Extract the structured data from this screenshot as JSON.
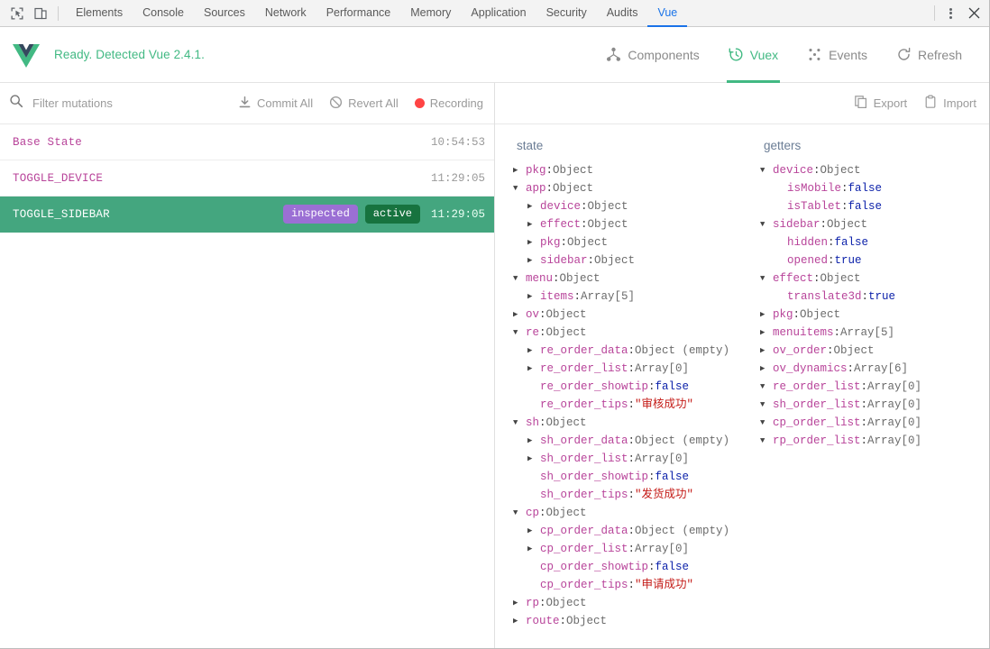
{
  "devtools": {
    "icons": {
      "inspect": "inspect-element-icon",
      "device": "device-toolbar-icon",
      "kebab": "more-options-icon",
      "close": "close-icon"
    },
    "tabs": [
      {
        "label": "Elements",
        "active": false
      },
      {
        "label": "Console",
        "active": false
      },
      {
        "label": "Sources",
        "active": false
      },
      {
        "label": "Network",
        "active": false
      },
      {
        "label": "Performance",
        "active": false
      },
      {
        "label": "Memory",
        "active": false
      },
      {
        "label": "Application",
        "active": false
      },
      {
        "label": "Security",
        "active": false
      },
      {
        "label": "Audits",
        "active": false
      },
      {
        "label": "Vue",
        "active": true
      }
    ]
  },
  "vue_header": {
    "logo": "vue-logo-icon",
    "status": "Ready. Detected Vue 2.4.1.",
    "actions": [
      {
        "label": "Components",
        "icon": "components-tree-icon",
        "active": false
      },
      {
        "label": "Vuex",
        "icon": "vuex-history-icon",
        "active": true
      },
      {
        "label": "Events",
        "icon": "events-dots-icon",
        "active": false
      },
      {
        "label": "Refresh",
        "icon": "refresh-icon",
        "active": false
      }
    ],
    "accent": "#42b983"
  },
  "mutations_panel": {
    "toolbar": {
      "search_icon": "search-icon",
      "filter_placeholder": "Filter mutations",
      "filter_value": "",
      "commit_all": "Commit All",
      "revert_all": "Revert All",
      "recording": "Recording",
      "recording_color": "#ff4444"
    },
    "rows": [
      {
        "name": "Base State",
        "time": "10:54:53",
        "badges": [],
        "active": false
      },
      {
        "name": "TOGGLE_DEVICE",
        "time": "11:29:05",
        "badges": [],
        "active": false
      },
      {
        "name": "TOGGLE_SIDEBAR",
        "time": "11:29:05",
        "badges": [
          "inspected",
          "active"
        ],
        "active": true
      }
    ],
    "badge_colors": {
      "inspected": "#9b6fd4",
      "active": "#17733f",
      "row_active": "#44a67f"
    }
  },
  "inspector": {
    "toolbar": {
      "export": "Export",
      "export_icon": "copy-icon",
      "import": "Import",
      "import_icon": "clipboard-icon"
    },
    "state": {
      "title": "state",
      "rows": [
        {
          "indent": 0,
          "caret": "collapsed",
          "key": "pkg",
          "value": "Object",
          "type": "object"
        },
        {
          "indent": 0,
          "caret": "expanded",
          "key": "app",
          "value": "Object",
          "type": "object"
        },
        {
          "indent": 1,
          "caret": "collapsed",
          "key": "device",
          "value": "Object",
          "type": "object"
        },
        {
          "indent": 1,
          "caret": "collapsed",
          "key": "effect",
          "value": "Object",
          "type": "object"
        },
        {
          "indent": 1,
          "caret": "collapsed",
          "key": "pkg",
          "value": "Object",
          "type": "object"
        },
        {
          "indent": 1,
          "caret": "collapsed",
          "key": "sidebar",
          "value": "Object",
          "type": "object"
        },
        {
          "indent": 0,
          "caret": "expanded",
          "key": "menu",
          "value": "Object",
          "type": "object"
        },
        {
          "indent": 1,
          "caret": "collapsed",
          "key": "items",
          "value": "Array[5]",
          "type": "object"
        },
        {
          "indent": 0,
          "caret": "collapsed",
          "key": "ov",
          "value": "Object",
          "type": "object"
        },
        {
          "indent": 0,
          "caret": "expanded",
          "key": "re",
          "value": "Object",
          "type": "object"
        },
        {
          "indent": 1,
          "caret": "collapsed",
          "key": "re_order_data",
          "value": "Object (empty)",
          "type": "object"
        },
        {
          "indent": 1,
          "caret": "collapsed",
          "key": "re_order_list",
          "value": "Array[0]",
          "type": "object"
        },
        {
          "indent": 1,
          "caret": "none",
          "key": "re_order_showtip",
          "value": "false",
          "type": "bool"
        },
        {
          "indent": 1,
          "caret": "none",
          "key": "re_order_tips",
          "value": "\"审核成功\"",
          "type": "string"
        },
        {
          "indent": 0,
          "caret": "expanded",
          "key": "sh",
          "value": "Object",
          "type": "object"
        },
        {
          "indent": 1,
          "caret": "collapsed",
          "key": "sh_order_data",
          "value": "Object (empty)",
          "type": "object"
        },
        {
          "indent": 1,
          "caret": "collapsed",
          "key": "sh_order_list",
          "value": "Array[0]",
          "type": "object"
        },
        {
          "indent": 1,
          "caret": "none",
          "key": "sh_order_showtip",
          "value": "false",
          "type": "bool"
        },
        {
          "indent": 1,
          "caret": "none",
          "key": "sh_order_tips",
          "value": "\"发货成功\"",
          "type": "string"
        },
        {
          "indent": 0,
          "caret": "expanded",
          "key": "cp",
          "value": "Object",
          "type": "object"
        },
        {
          "indent": 1,
          "caret": "collapsed",
          "key": "cp_order_data",
          "value": "Object (empty)",
          "type": "object"
        },
        {
          "indent": 1,
          "caret": "collapsed",
          "key": "cp_order_list",
          "value": "Array[0]",
          "type": "object"
        },
        {
          "indent": 1,
          "caret": "none",
          "key": "cp_order_showtip",
          "value": "false",
          "type": "bool"
        },
        {
          "indent": 1,
          "caret": "none",
          "key": "cp_order_tips",
          "value": "\"申请成功\"",
          "type": "string"
        },
        {
          "indent": 0,
          "caret": "collapsed",
          "key": "rp",
          "value": "Object",
          "type": "object"
        },
        {
          "indent": 0,
          "caret": "collapsed",
          "key": "route",
          "value": "Object",
          "type": "object"
        }
      ]
    },
    "getters": {
      "title": "getters",
      "rows": [
        {
          "indent": 0,
          "caret": "expanded",
          "key": "device",
          "value": "Object",
          "type": "object"
        },
        {
          "indent": 1,
          "caret": "none",
          "key": "isMobile",
          "value": "false",
          "type": "bool"
        },
        {
          "indent": 1,
          "caret": "none",
          "key": "isTablet",
          "value": "false",
          "type": "bool"
        },
        {
          "indent": 0,
          "caret": "expanded",
          "key": "sidebar",
          "value": "Object",
          "type": "object"
        },
        {
          "indent": 1,
          "caret": "none",
          "key": "hidden",
          "value": "false",
          "type": "bool"
        },
        {
          "indent": 1,
          "caret": "none",
          "key": "opened",
          "value": "true",
          "type": "bool"
        },
        {
          "indent": 0,
          "caret": "expanded",
          "key": "effect",
          "value": "Object",
          "type": "object"
        },
        {
          "indent": 1,
          "caret": "none",
          "key": "translate3d",
          "value": "true",
          "type": "bool"
        },
        {
          "indent": 0,
          "caret": "collapsed",
          "key": "pkg",
          "value": "Object",
          "type": "object"
        },
        {
          "indent": 0,
          "caret": "collapsed",
          "key": "menuitems",
          "value": "Array[5]",
          "type": "object"
        },
        {
          "indent": 0,
          "caret": "collapsed",
          "key": "ov_order",
          "value": "Object",
          "type": "object"
        },
        {
          "indent": 0,
          "caret": "collapsed",
          "key": "ov_dynamics",
          "value": "Array[6]",
          "type": "object"
        },
        {
          "indent": 0,
          "caret": "expanded",
          "key": "re_order_list",
          "value": "Array[0]",
          "type": "object"
        },
        {
          "indent": 0,
          "caret": "expanded",
          "key": "sh_order_list",
          "value": "Array[0]",
          "type": "object"
        },
        {
          "indent": 0,
          "caret": "expanded",
          "key": "cp_order_list",
          "value": "Array[0]",
          "type": "object"
        },
        {
          "indent": 0,
          "caret": "expanded",
          "key": "rp_order_list",
          "value": "Array[0]",
          "type": "object"
        }
      ]
    }
  }
}
